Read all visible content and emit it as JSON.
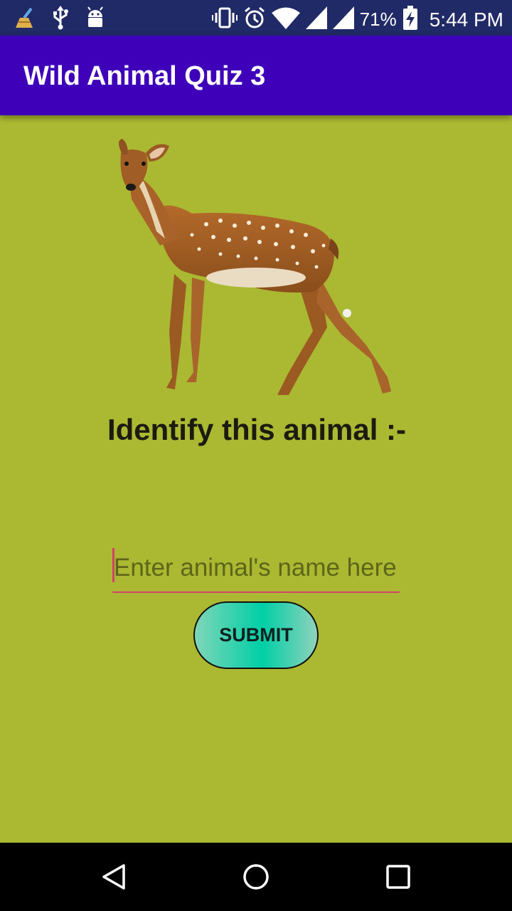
{
  "status_bar": {
    "battery_percent": "71%",
    "time": "5:44 PM",
    "icons": [
      "cleaner-broom-icon",
      "usb-icon",
      "android-debug-icon",
      "vibrate-icon",
      "alarm-icon",
      "wifi-icon",
      "signal-icon",
      "signal-icon",
      "battery-charging-icon"
    ]
  },
  "app_bar": {
    "title": "Wild Animal Quiz 3",
    "color": "#3f00b9"
  },
  "main": {
    "background": "#abb932",
    "image": "deer-image",
    "question": "Identify this animal :-",
    "answer_input": {
      "value": "",
      "placeholder": "Enter animal's name here"
    },
    "submit_label": "SUBMIT"
  },
  "nav_bar": {
    "icons": [
      "back-icon",
      "home-icon",
      "recents-icon"
    ]
  }
}
